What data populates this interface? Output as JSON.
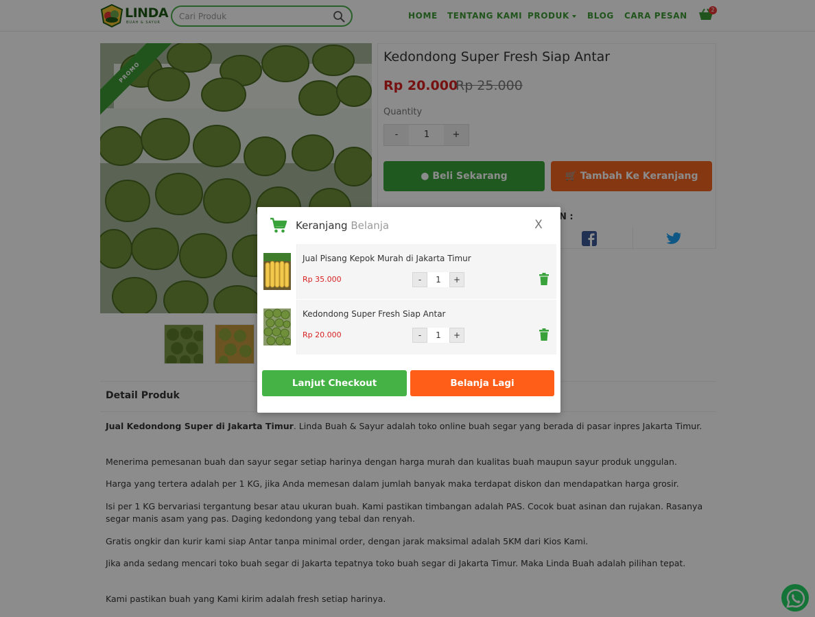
{
  "header": {
    "logo_title": "LINDA",
    "logo_subtitle": "BUAH & SAYUR",
    "search_placeholder": "Cari Produk",
    "nav": {
      "home": "HOME",
      "tentang": "TENTANG KAMI",
      "produk": "PRODUK",
      "blog": "BLOG",
      "cara_pesan": "CARA PESAN"
    },
    "cart_count": "2"
  },
  "product": {
    "ribbon": "PROMO",
    "title": "Kedondong Super Fresh Siap Antar",
    "price": "Rp 20.000",
    "old_price": "Rp 25.000",
    "quantity_label": "Quantity",
    "quantity_value": "1",
    "minus": "-",
    "plus": "+",
    "buy_label": "Beli Sekarang",
    "add_cart_label": "Tambah Ke Keranjang",
    "share_label": "N :"
  },
  "details": {
    "heading": "Detail Produk",
    "p1_bold": "Jual Kedondong Super di Jakarta Timur",
    "p1_rest": ". Linda Buah & Sayur adalah toko online buah segar yang berada di pasar inpres Jakarta Timur.",
    "p2": "Menerima pemesanan buah dan sayur segar setiap harinya dengan harga murah dan kualitas buah maupun sayur produk unggulan.",
    "p3": "Harga yang tertera adalah per 1 KG, jika Anda memesan dalam jumlah banyak maka terdapat diskon dan mendapatkan harga grosir.",
    "p4": "Isi per 1 KG bervariasi tergantung besar atau ukuran buah. Kami pastikan timbangan adalah PAS. Cocok buat asinan dan rujakan. Rasanya segar manis asam yang pas. Daging kedondong yang tebal dan renyah.",
    "p5": "Gratis ongkir dan kurir kami siap Antar tanpa minimal order, dengan jarak maksimal adalah 5KM dari Kios Kami.",
    "p6": "Jika anda sedang mencari toko buah segar di Jakarta tepatnya toko buah segar di Jakarta Timur. Maka Linda Buah adalah pilihan tepat.",
    "p7": "Kami pastikan buah yang Kami kirim adalah fresh setiap harinya."
  },
  "modal": {
    "title_strong": "Keranjang",
    "title_light": "Belanja",
    "close": "X",
    "items": [
      {
        "name": "Jual Pisang Kepok Murah di Jakarta Timur",
        "price": "Rp 35.000",
        "qty": "1",
        "minus": "-",
        "plus": "+"
      },
      {
        "name": "Kedondong Super Fresh Siap Antar",
        "price": "Rp 20.000",
        "qty": "1",
        "minus": "-",
        "plus": "+"
      }
    ],
    "checkout_label": "Lanjut Checkout",
    "continue_label": "Belanja Lagi"
  },
  "colors": {
    "brand_green": "#3d9a34",
    "accent_orange": "#f26522",
    "price_red": "#d82020"
  },
  "icons": [
    "search-icon",
    "cart-icon",
    "whatsapp-icon",
    "facebook-icon",
    "twitter-icon",
    "trash-icon",
    "close-icon"
  ]
}
